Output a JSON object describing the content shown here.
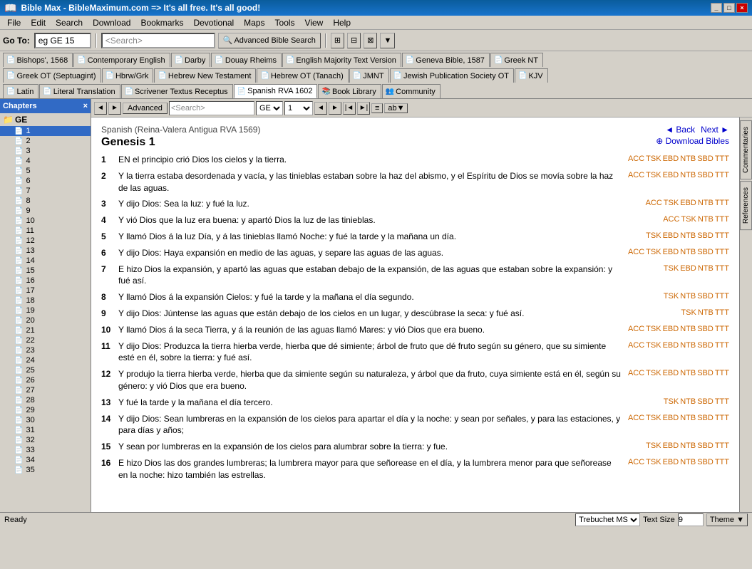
{
  "titlebar": {
    "title": "Bible Max - BibleMaximum.com => It's all free. It's all good!",
    "icon": "📖",
    "controls": [
      "_",
      "□",
      "×"
    ]
  },
  "menubar": {
    "items": [
      "File",
      "Edit",
      "Search",
      "Download",
      "Bookmarks",
      "Devotional",
      "Maps",
      "Tools",
      "View",
      "Help"
    ]
  },
  "toolbar": {
    "goto_label": "Go To:",
    "goto_value": "eg GE 15",
    "search_placeholder": "<Search>",
    "search_button": "Advanced Bible Search",
    "buttons": [
      "⊞",
      "⊟",
      "⊠",
      "▼"
    ]
  },
  "tabs_row1": [
    {
      "label": "Bishops', 1568",
      "active": false
    },
    {
      "label": "Contemporary English",
      "active": false
    },
    {
      "label": "Darby",
      "active": false
    },
    {
      "label": "Douay Rheims",
      "active": false
    },
    {
      "label": "English Majority Text Version",
      "active": false
    },
    {
      "label": "Geneva Bible, 1587",
      "active": false
    },
    {
      "label": "Greek NT",
      "active": false
    }
  ],
  "tabs_row2": [
    {
      "label": "Greek OT (Septuagint)",
      "active": false
    },
    {
      "label": "Hbrw/Grk",
      "active": false
    },
    {
      "label": "Hebrew New Testament",
      "active": false
    },
    {
      "label": "Hebrew OT (Tanach)",
      "active": false
    },
    {
      "label": "JMNT",
      "active": false
    },
    {
      "label": "Jewish Publication Society OT",
      "active": false
    },
    {
      "label": "KJV",
      "active": false
    }
  ],
  "tabs_row3": [
    {
      "label": "Latin",
      "active": false
    },
    {
      "label": "Literal Translation",
      "active": false
    },
    {
      "label": "Scrivener Textus Receptus",
      "active": false
    },
    {
      "label": "Spanish RVA 1602",
      "active": true
    },
    {
      "label": "Book Library",
      "active": false
    },
    {
      "label": "Community",
      "active": false
    }
  ],
  "sidebar": {
    "header": "Chapters",
    "book": "GE",
    "chapters": [
      1,
      2,
      3,
      4,
      5,
      6,
      7,
      8,
      9,
      10,
      11,
      12,
      13,
      14,
      15,
      16,
      17,
      18,
      19,
      20,
      21,
      22,
      23,
      24,
      25,
      26,
      27,
      28,
      29,
      30,
      31,
      32,
      33,
      34,
      35
    ]
  },
  "content_toolbar": {
    "search_placeholder": "<Search>",
    "book_value": "GE",
    "chapter_value": "1"
  },
  "bible": {
    "version": "Spanish (Reina-Valera Antigua RVA 1569)",
    "book_chapter": "Genesis 1",
    "nav_back": "◄ Back",
    "nav_next": "Next ►",
    "download": "⊕ Download Bibles",
    "verses": [
      {
        "num": 1,
        "text": "EN el principio crió Dios los cielos y la tierra.",
        "links": [
          "ACC",
          "TSK",
          "EBD",
          "NTB",
          "SBD",
          "TTT"
        ]
      },
      {
        "num": 2,
        "text": "Y la tierra estaba desordenada y vacía, y las tinieblas estaban sobre la haz del abismo, y el Espíritu de Dios se movía sobre la haz de las aguas.",
        "links": [
          "ACC",
          "TSK",
          "EBD",
          "NTB",
          "SBD",
          "TTT"
        ]
      },
      {
        "num": 3,
        "text": "Y dijo Dios: Sea la luz: y fué la luz.",
        "links": [
          "ACC",
          "TSK",
          "EBD",
          "NTB",
          "TTT"
        ]
      },
      {
        "num": 4,
        "text": "Y vió Dios que la luz era buena: y apartó Dios la luz de las tinieblas.",
        "links": [
          "ACC",
          "TSK",
          "NTB",
          "TTT"
        ]
      },
      {
        "num": 5,
        "text": "Y llamó Dios á la luz Día, y á las tinieblas llamó Noche: y fué la tarde y la mañana un día.",
        "links": [
          "TSK",
          "EBD",
          "NTB",
          "SBD",
          "TTT"
        ]
      },
      {
        "num": 6,
        "text": "Y dijo Dios: Haya expansión en medio de las aguas, y separe las aguas de las aguas.",
        "links": [
          "ACC",
          "TSK",
          "EBD",
          "NTB",
          "SBD",
          "TTT"
        ]
      },
      {
        "num": 7,
        "text": "E hizo Dios la expansión, y apartó las aguas que estaban debajo de la expansión, de las aguas que estaban sobre la expansión: y fué así.",
        "links": [
          "TSK",
          "EBD",
          "NTB",
          "TTT"
        ]
      },
      {
        "num": 8,
        "text": "Y llamó Dios á la expansión Cielos: y fué la tarde y la mañana el día segundo.",
        "links": [
          "TSK",
          "NTB",
          "SBD",
          "TTT"
        ]
      },
      {
        "num": 9,
        "text": "Y dijo Dios: Júntense las aguas que están debajo de los cielos en un lugar, y descúbrase la seca: y fué así.",
        "links": [
          "TSK",
          "NTB",
          "TTT"
        ]
      },
      {
        "num": 10,
        "text": "Y llamó Dios á la seca Tierra, y á la reunión de las aguas llamó Mares: y vió Dios que era bueno.",
        "links": [
          "ACC",
          "TSK",
          "EBD",
          "NTB",
          "SBD",
          "TTT"
        ]
      },
      {
        "num": 11,
        "text": "Y dijo Dios: Produzca la tierra hierba verde, hierba que dé simiente; árbol de fruto que dé fruto según su género, que su simiente esté en él, sobre la tierra: y fué así.",
        "links": [
          "ACC",
          "TSK",
          "EBD",
          "NTB",
          "SBD",
          "TTT"
        ]
      },
      {
        "num": 12,
        "text": "Y produjo la tierra hierba verde, hierba que da simiente según su naturaleza, y árbol que da fruto, cuya simiente está en él, según su género: y vió Dios que era bueno.",
        "links": [
          "ACC",
          "TSK",
          "EBD",
          "NTB",
          "SBD",
          "TTT"
        ]
      },
      {
        "num": 13,
        "text": "Y fué la tarde y la mañana el día tercero.",
        "links": [
          "TSK",
          "NTB",
          "SBD",
          "TTT"
        ]
      },
      {
        "num": 14,
        "text": "Y dijo Dios: Sean lumbreras en la expansión de los cielos para apartar el día y la noche: y sean por señales, y para las estaciones, y para días y años;",
        "links": [
          "ACC",
          "TSK",
          "EBD",
          "NTB",
          "SBD",
          "TTT"
        ]
      },
      {
        "num": 15,
        "text": "Y sean por lumbreras en la expansión de los cielos para alumbrar sobre la tierra: y fue.",
        "links": [
          "TSK",
          "EBD",
          "NTB",
          "SBD",
          "TTT"
        ]
      },
      {
        "num": 16,
        "text": "E hizo Dios las dos grandes lumbreras; la lumbrera mayor para que señorease en el día, y la lumbrera menor para que señorease en la noche: hizo también las estrellas.",
        "links": [
          "ACC",
          "TSK",
          "EBD",
          "NTB",
          "SBD",
          "TTT"
        ]
      }
    ]
  },
  "vertical_tabs": [
    "Commentaries",
    "References"
  ],
  "statusbar": {
    "status": "Ready",
    "font": "Trebuchet MS",
    "text_size_label": "Text Size",
    "text_size_value": "9",
    "theme_label": "Theme"
  }
}
